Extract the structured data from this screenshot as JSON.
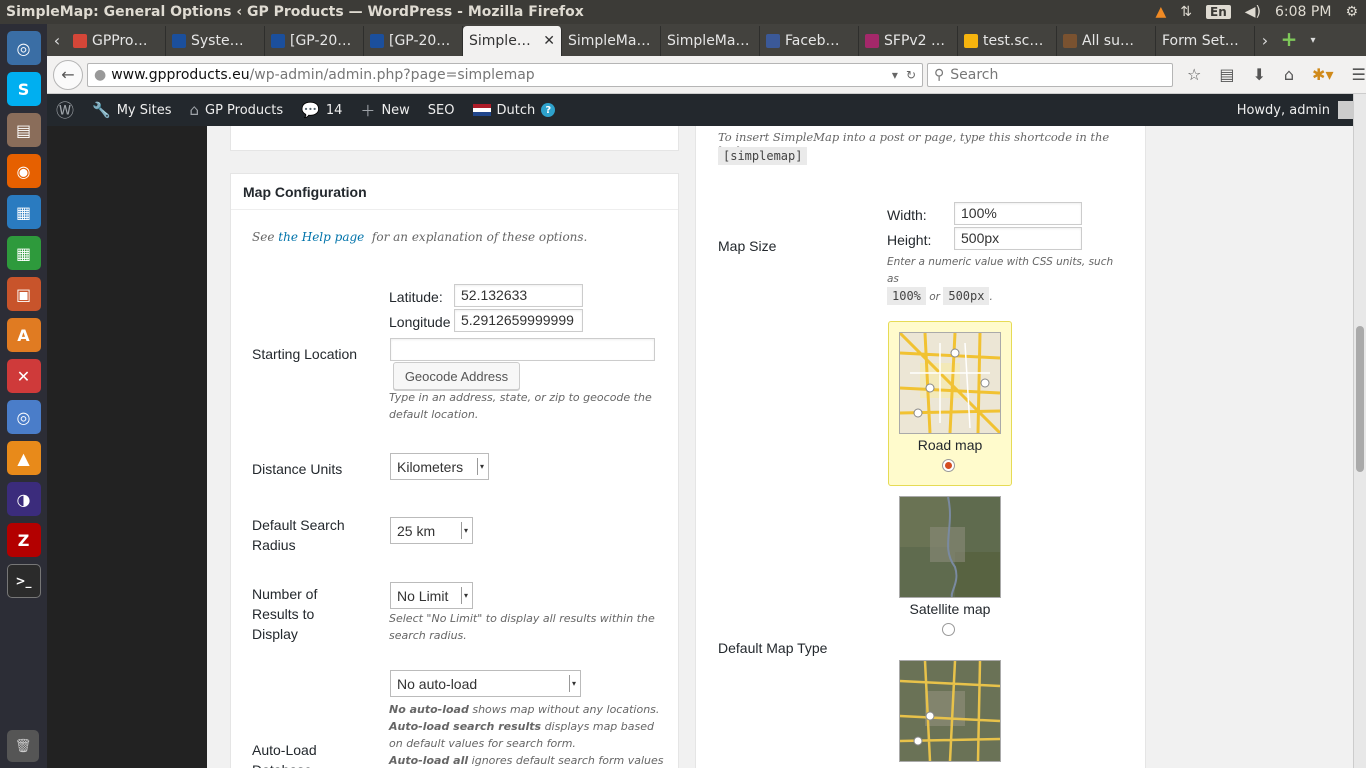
{
  "window": {
    "title": "SimpleMap: General Options ‹ GP Products — WordPress - Mozilla Firefox"
  },
  "tray": {
    "lang": "En",
    "time": "6:08 PM"
  },
  "tabs": [
    {
      "label": "GPPro…",
      "icon": "gmail-icon",
      "color": "#d44638"
    },
    {
      "label": "Syste…",
      "icon": "joomla-icon",
      "color": "#1b4f9c"
    },
    {
      "label": "[GP-20…",
      "icon": "joomla-icon",
      "color": "#1b4f9c"
    },
    {
      "label": "[GP-20…",
      "icon": "joomla-icon",
      "color": "#1b4f9c"
    },
    {
      "label": "Simple…",
      "icon": "none",
      "color": "#f2f1f0",
      "active": true
    },
    {
      "label": "SimpleMa…",
      "icon": "none",
      "color": "#43423e"
    },
    {
      "label": "SimpleMa…",
      "icon": "none",
      "color": "#43423e"
    },
    {
      "label": "Faceb…",
      "icon": "facebook-icon",
      "color": "#3b5998"
    },
    {
      "label": "SFPv2 …",
      "icon": "yoast-icon",
      "color": "#a4286a"
    },
    {
      "label": "test.sc…",
      "icon": "gp-icon",
      "color": "#f6b40e"
    },
    {
      "label": "All su…",
      "icon": "user-icon",
      "color": "#7a5230"
    },
    {
      "label": "Form Set…",
      "icon": "none",
      "color": "#43423e"
    }
  ],
  "nav": {
    "url_host": "www.gpproducts.eu",
    "url_path": "/wp-admin/admin.php?page=simplemap",
    "search_placeholder": "Search"
  },
  "adminbar": {
    "my_sites": "My Sites",
    "site_name": "GP Products",
    "comments_count": "14",
    "new_label": "New",
    "seo_label": "SEO",
    "language": "Dutch",
    "howdy": "Howdy, admin"
  },
  "map_config": {
    "title": "Map Configuration",
    "help_prefix": "See",
    "help_link": "the Help page",
    "help_suffix": "for an explanation of these options.",
    "starting_location_label": "Starting Location",
    "latitude_label": "Latitude:",
    "latitude_value": "52.132633",
    "longitude_label": "Longitude",
    "longitude_value": "5.2912659999999",
    "address_value": "",
    "geocode_button": "Geocode Address",
    "geocode_desc": "Type in an address, state, or zip to geocode the default location.",
    "distance_units_label": "Distance Units",
    "distance_units_value": "Kilometers",
    "search_radius_label": "Default Search Radius",
    "search_radius_value": "25 km",
    "results_label": "Number of Results to Display",
    "results_value": "No Limit",
    "results_desc": "Select \"No Limit\" to display all results within the search radius.",
    "autoload_label": "Auto-Load Database",
    "autoload_value": "No auto-load",
    "autoload_desc1_b": "No auto-load",
    "autoload_desc1": "shows map without any locations.",
    "autoload_desc2_b": "Auto-load search results",
    "autoload_desc2": "displays map based on default values for search form.",
    "autoload_desc3_b": "Auto-load all",
    "autoload_desc3": "ignores default search form values and"
  },
  "right": {
    "shortcode_text": "To insert SimpleMap into a post or page, type this shortcode in the body:",
    "shortcode": "[simplemap]",
    "map_size_label": "Map Size",
    "width_label": "Width:",
    "width_value": "100%",
    "height_label": "Height:",
    "height_value": "500px",
    "size_desc": "Enter a numeric value with CSS units, such as",
    "size_ex1": "100%",
    "size_or": "or",
    "size_ex2": "500px",
    "default_map_type_label": "Default Map Type",
    "road_map": "Road map",
    "satellite_map": "Satellite map",
    "selected_map_type": "road"
  }
}
